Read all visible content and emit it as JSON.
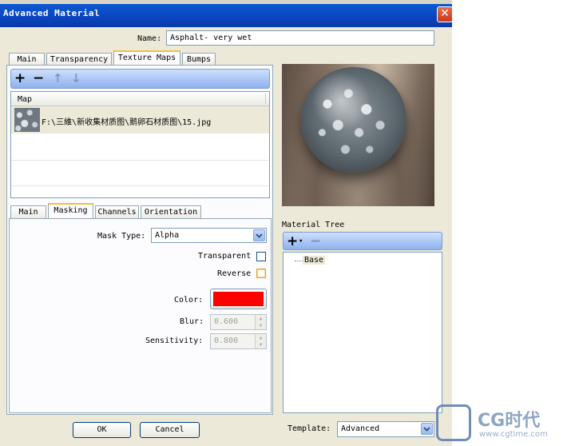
{
  "window": {
    "title": "Advanced Material",
    "close_glyph": "✕"
  },
  "name_field": {
    "label": "Name:",
    "value": "Asphalt- very wet"
  },
  "main_tabs": [
    "Main",
    "Transparency",
    "Texture Maps",
    "Bumps"
  ],
  "map_toolbar": {
    "add": "+",
    "remove": "−",
    "up": "↑",
    "down": "↓"
  },
  "map_list": {
    "header": "Map",
    "rows": [
      {
        "path": "F:\\三維\\新收集材质图\\鹅卵石材质图\\15.jpg"
      }
    ]
  },
  "sub_tabs": [
    "Main",
    "Masking",
    "Channels",
    "Orientation"
  ],
  "masking": {
    "mask_type_label": "Mask Type:",
    "mask_type_value": "Alpha",
    "transparent_label": "Transparent",
    "reverse_label": "Reverse",
    "color_label": "Color:",
    "color_value": "#ff0000",
    "blur_label": "Blur:",
    "blur_value": "0.600",
    "sensitivity_label": "Sensitivity:",
    "sensitivity_value": "0.800"
  },
  "material_tree": {
    "label": "Material Tree",
    "add": "+",
    "add_arrow": "▾",
    "remove": "−",
    "items": [
      "Base"
    ]
  },
  "template": {
    "label": "Template:",
    "value": "Advanced"
  },
  "buttons": {
    "ok": "OK",
    "cancel": "Cancel"
  },
  "watermark": {
    "text": "CG时代",
    "domain": "www.cgtime.com"
  },
  "colors": {
    "title_bar": "#0b46c1",
    "dialog_bg": "#ece9d8",
    "toolbar_blue": "#a9c6f5",
    "mask_color": "#ff0000"
  }
}
